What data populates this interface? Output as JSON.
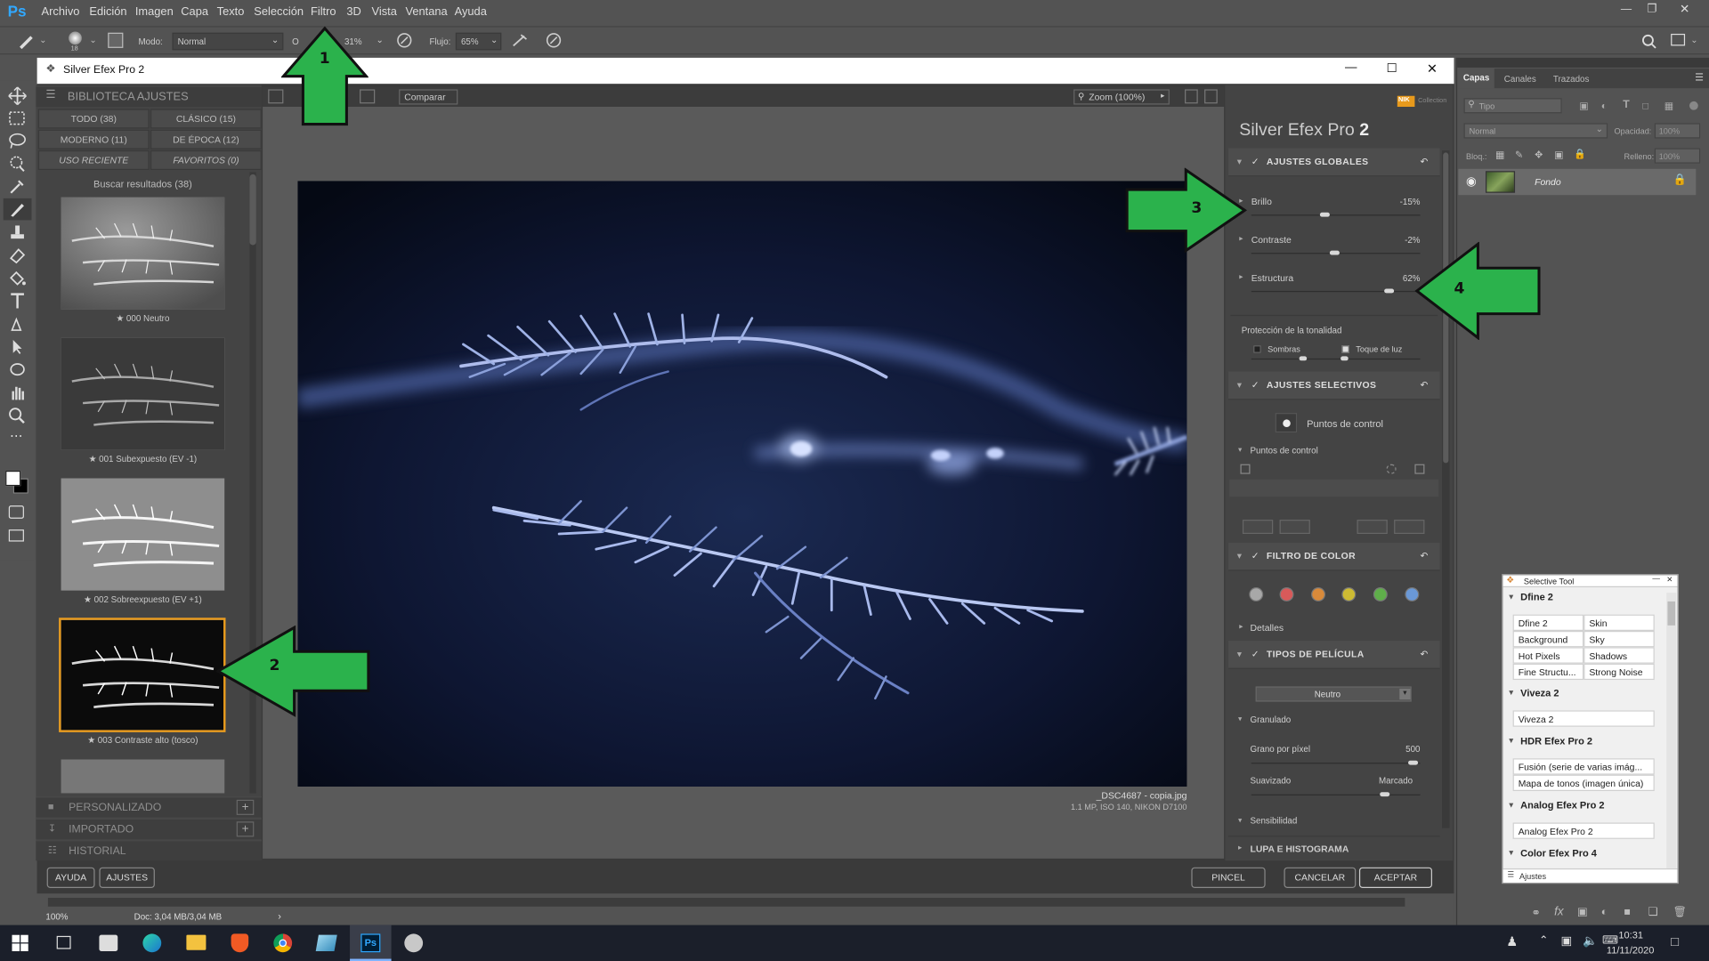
{
  "ps": {
    "logo": "Ps",
    "menu": [
      "Archivo",
      "Edición",
      "Imagen",
      "Capa",
      "Texto",
      "Selección",
      "Filtro",
      "3D",
      "Vista",
      "Ventana",
      "Ayuda"
    ],
    "options": {
      "brush_size": "18",
      "modo_label": "Modo:",
      "modo_value": "Normal",
      "opacidad_partial": "O",
      "opacidad_value": "31%",
      "flujo_label": "Flujo:",
      "flujo_value": "65%"
    },
    "status": {
      "zoom": "100%",
      "doc": "Doc: 3,04 MB/3,04 MB"
    }
  },
  "layers_panel": {
    "tabs": [
      "Capas",
      "Canales",
      "Trazados"
    ],
    "filter_placeholder": "Tipo",
    "blend_mode": "Normal",
    "opacity_label": "Opacidad:",
    "opacity_value": "100%",
    "lock_label": "Bloq.:",
    "fill_label": "Relleno:",
    "fill_value": "100%",
    "layer_name": "Fondo"
  },
  "dialog": {
    "title": "Silver Efex Pro 2",
    "library": {
      "header": "BIBLIOTECA AJUSTES",
      "tabs": [
        "TODO (38)",
        "CLÁSICO (15)",
        "MODERNO (11)",
        "DE ÉPOCA (12)",
        "USO RECIENTE",
        "FAVORITOS (0)"
      ],
      "search_results": "Buscar resultados (38)",
      "presets": [
        {
          "label": "000 Neutro",
          "star": "★"
        },
        {
          "label": "001 Subexpuesto (EV -1)",
          "star": "★"
        },
        {
          "label": "002 Sobreexpuesto (EV +1)",
          "star": "★"
        },
        {
          "label": "003 Contraste alto (tosco)",
          "star": "★"
        }
      ],
      "sections": [
        "PERSONALIZADO",
        "IMPORTADO",
        "HISTORIAL"
      ],
      "section_add": "+"
    },
    "toolbar": {
      "compare": "Comparar",
      "zoom": "Zoom (100%)"
    },
    "image_info": {
      "filename": "_DSC4687 - copia.jpg",
      "meta": "1.1 MP, ISO 140, NIKON D7100"
    },
    "right_panel": {
      "brand_small": "Collection",
      "brand_nik": "NIK",
      "title": "Silver Efex Pro",
      "title_num": "2",
      "global": {
        "header": "AJUSTES GLOBALES",
        "sliders": [
          {
            "label": "Brillo",
            "value": "-15%",
            "level": 0.43
          },
          {
            "label": "Contraste",
            "value": "-2%",
            "level": 0.49
          },
          {
            "label": "Estructura",
            "value": "62%",
            "level": 0.81
          }
        ],
        "tonal_protection": "Protección de la tonalidad",
        "shadows": "Sombras",
        "highlights": "Toque de luz"
      },
      "selective": {
        "header": "AJUSTES SELECTIVOS",
        "control_points": "Puntos de control",
        "control_points_sub": "Puntos de control"
      },
      "color_filter": {
        "header": "FILTRO DE COLOR",
        "colors": [
          "#a8a8a8",
          "#d85a5a",
          "#d98a3a",
          "#cdbb33",
          "#5fae4a",
          "#6a98d6"
        ],
        "details": "Detalles"
      },
      "film": {
        "header": "TIPOS DE PELÍCULA",
        "preset": "Neutro",
        "grain": "Granulado",
        "grain_per_px": "Grano por píxel",
        "grain_value": "500",
        "soft": "Suavizado",
        "marked": "Marcado",
        "sensitivity": "Sensibilidad"
      },
      "loupe": "LUPA E HISTOGRAMA"
    },
    "footer": {
      "help": "AYUDA",
      "settings": "AJUSTES",
      "brush": "PINCEL",
      "cancel": "CANCELAR",
      "accept": "ACEPTAR"
    }
  },
  "selective_tool": {
    "title": "Selective Tool",
    "groups": [
      {
        "name": "Dfine 2",
        "items": [
          "Dfine 2",
          "Skin",
          "Background",
          "Sky",
          "Hot Pixels",
          "Shadows",
          "Fine Structu...",
          "Strong Noise"
        ]
      },
      {
        "name": "Viveza 2",
        "items": [
          "Viveza 2"
        ]
      },
      {
        "name": "HDR Efex Pro 2",
        "items": [
          "Fusión (serie de varias imág...",
          "Mapa de tonos (imagen única)"
        ]
      },
      {
        "name": "Analog Efex Pro 2",
        "items": [
          "Analog Efex Pro 2"
        ]
      },
      {
        "name": "Color Efex Pro 4",
        "items": []
      }
    ],
    "footer": "Ajustes"
  },
  "annotations": [
    "1",
    "2",
    "3",
    "4"
  ],
  "taskbar": {
    "time": "10:31",
    "date": "11/11/2020"
  }
}
